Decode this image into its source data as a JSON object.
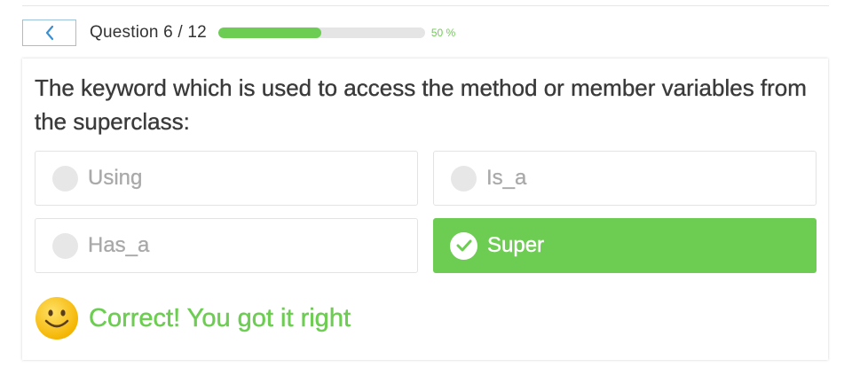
{
  "colors": {
    "accent_green": "#6dcd52",
    "back_arrow": "#3b8fd0",
    "track": "#e5e5e5"
  },
  "header": {
    "back_icon": "chevron-left-icon",
    "counter": "Question 6 / 12",
    "progress_fraction": 0.5,
    "percent_label": "50 %"
  },
  "question": {
    "text": "The keyword which is used to access the method or member variables from the superclass:"
  },
  "options": [
    {
      "label": "Using",
      "selected": false
    },
    {
      "label": "Is_a",
      "selected": false
    },
    {
      "label": "Has_a",
      "selected": false
    },
    {
      "label": "Super",
      "selected": true
    }
  ],
  "feedback": {
    "icon": "smiley-icon",
    "message": "Correct! You got it right"
  }
}
